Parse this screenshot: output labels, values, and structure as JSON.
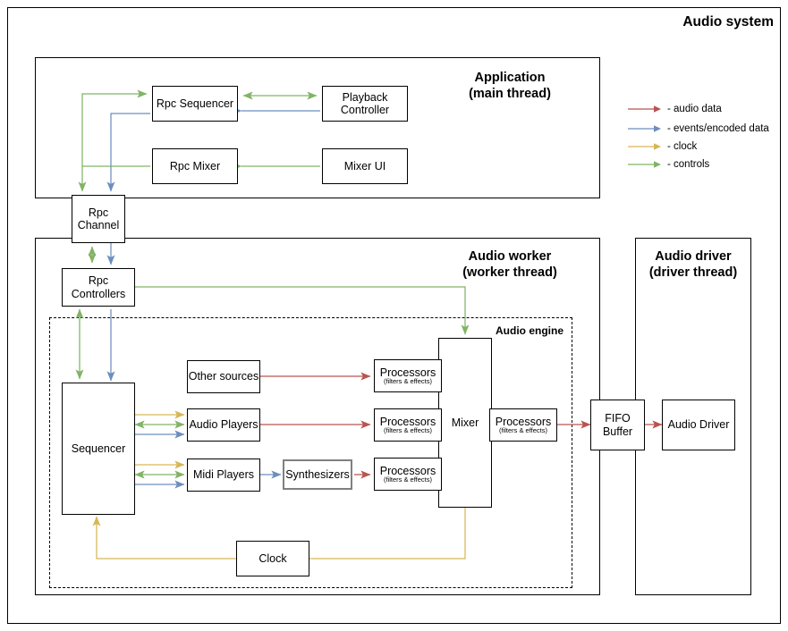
{
  "title": "Audio system",
  "legend": {
    "items": [
      {
        "label": "- audio data",
        "color": "#b85450",
        "icon": "arrow-right-icon"
      },
      {
        "label": "- events/encoded data",
        "color": "#6c8ebf",
        "icon": "arrow-right-icon"
      },
      {
        "label": "- clock",
        "color": "#d6b656",
        "icon": "arrow-right-icon"
      },
      {
        "label": "- controls",
        "color": "#82b366",
        "icon": "arrow-right-icon"
      }
    ]
  },
  "panels": {
    "application": {
      "line1": "Application",
      "line2": "(main thread)"
    },
    "audio_worker": {
      "line1": "Audio worker",
      "line2": "(worker thread)"
    },
    "audio_driver": {
      "line1": "Audio driver",
      "line2": "(driver thread)"
    },
    "audio_engine": {
      "label": "Audio engine"
    }
  },
  "boxes": {
    "rpc_sequencer": {
      "label": "Rpc Sequencer"
    },
    "playback_controller": {
      "line1": "Playback",
      "line2": "Controller"
    },
    "rpc_mixer": {
      "label": "Rpc Mixer"
    },
    "mixer_ui": {
      "label": "Mixer UI"
    },
    "rpc_channel": {
      "line1": "Rpc",
      "line2": "Channel"
    },
    "rpc_controllers": {
      "line1": "Rpc",
      "line2": "Controllers"
    },
    "sequencer": {
      "label": "Sequencer"
    },
    "other_sources": {
      "label": "Other sources"
    },
    "audio_players": {
      "label": "Audio Players"
    },
    "midi_players": {
      "label": "Midi Players"
    },
    "synthesizers": {
      "label": "Synthesizers"
    },
    "processors_other": {
      "label": "Processors",
      "sub": "(filters & effects)"
    },
    "processors_audio": {
      "label": "Processors",
      "sub": "(filters & effects)"
    },
    "processors_midi": {
      "label": "Processors",
      "sub": "(filters & effects)"
    },
    "processors_master": {
      "label": "Processors",
      "sub": "(filters & effects)"
    },
    "mixer": {
      "label": "Mixer"
    },
    "fifo_buffer": {
      "line1": "FIFO",
      "line2": "Buffer"
    },
    "audio_driver_box": {
      "label": "Audio Driver"
    },
    "clock": {
      "label": "Clock"
    }
  },
  "colors": {
    "audio_data": "#b85450",
    "events": "#6c8ebf",
    "clock": "#d6b656",
    "controls": "#82b366",
    "stroke": "#000000",
    "gray_border": "#808080"
  }
}
